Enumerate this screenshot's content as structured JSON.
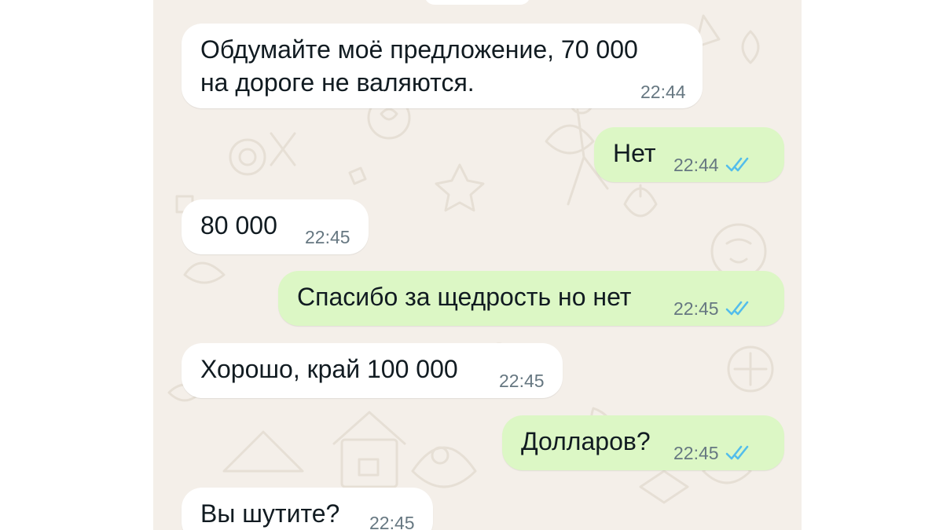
{
  "colors": {
    "wallpaper": "#f4efe9",
    "incoming_bubble": "#ffffff",
    "outgoing_bubble": "#dcf7c5",
    "timestamp": "#667781",
    "read_ticks": "#53bdeb"
  },
  "messages": [
    {
      "direction": "incoming",
      "text_line1": "Обдумайте моё предложение, 70 000",
      "text_line2": "на дороге не валяются.",
      "time": "22:44"
    },
    {
      "direction": "outgoing",
      "text": "Нет",
      "time": "22:44",
      "status": "read"
    },
    {
      "direction": "incoming",
      "text": "80 000",
      "time": "22:45"
    },
    {
      "direction": "outgoing",
      "text": "Спасибо за щедрость но нет",
      "time": "22:45",
      "status": "read"
    },
    {
      "direction": "incoming",
      "text": "Хорошо, край 100 000",
      "time": "22:45"
    },
    {
      "direction": "outgoing",
      "text": "Долларов?",
      "time": "22:45",
      "status": "read"
    },
    {
      "direction": "incoming",
      "text": "Вы шутите?",
      "time": "22:45"
    }
  ],
  "icons": {
    "read_status": "double-check-icon"
  }
}
